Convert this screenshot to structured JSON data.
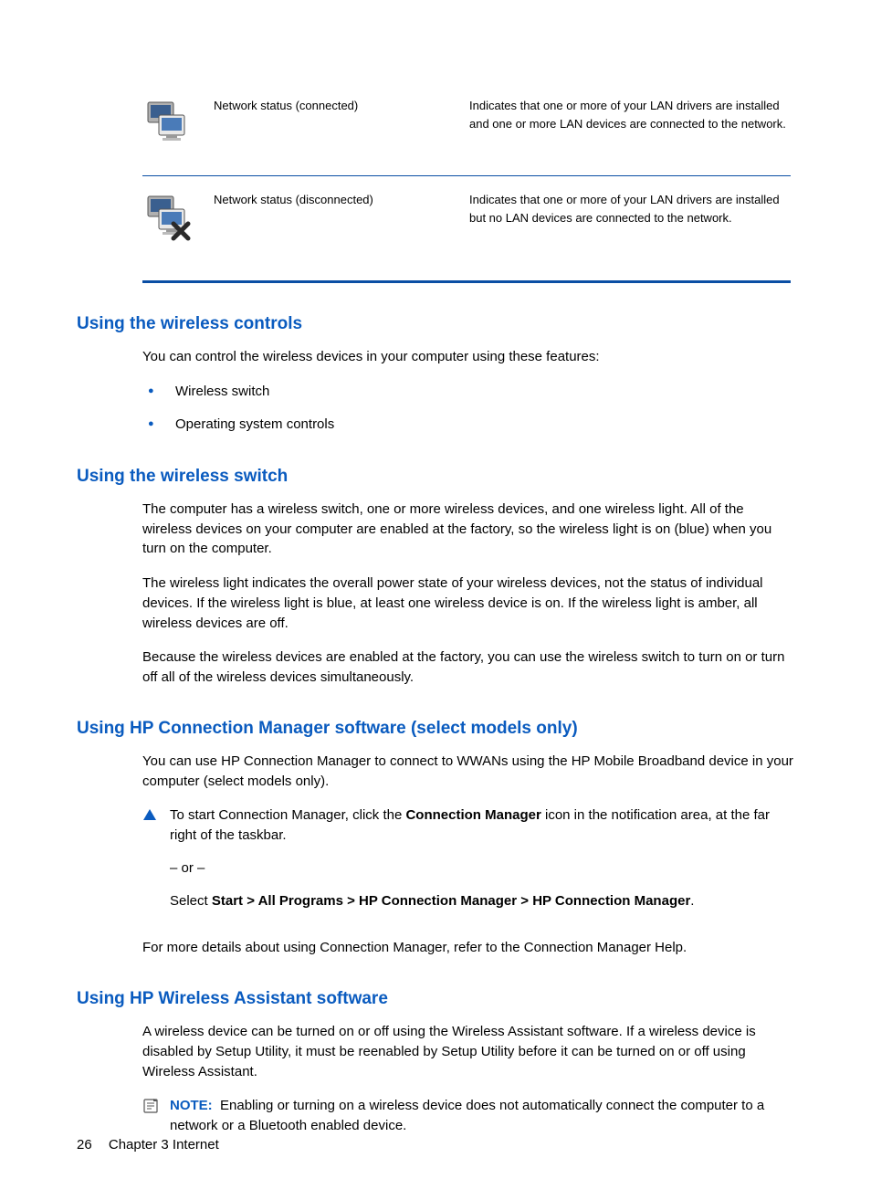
{
  "table": {
    "rows": [
      {
        "label": "Network status (connected)",
        "desc": "Indicates that one or more of your LAN drivers are installed and one or more LAN devices are connected to the network."
      },
      {
        "label": "Network status (disconnected)",
        "desc": "Indicates that one or more of your LAN drivers are installed but no LAN devices are connected to the network."
      }
    ]
  },
  "sections": {
    "s1": {
      "heading": "Using the wireless controls",
      "intro": "You can control the wireless devices in your computer using these features:",
      "bullets": [
        "Wireless switch",
        "Operating system controls"
      ]
    },
    "s2": {
      "heading": "Using the wireless switch",
      "p1": "The computer has a wireless switch, one or more wireless devices, and one wireless light. All of the wireless devices on your computer are enabled at the factory, so the wireless light is on (blue) when you turn on the computer.",
      "p2": "The wireless light indicates the overall power state of your wireless devices, not the status of individual devices. If the wireless light is blue, at least one wireless device is on. If the wireless light is amber, all wireless devices are off.",
      "p3": "Because the wireless devices are enabled at the factory, you can use the wireless switch to turn on or turn off all of the wireless devices simultaneously."
    },
    "s3": {
      "heading": "Using HP Connection Manager software (select models only)",
      "p1": "You can use HP Connection Manager to connect to WWANs using the HP Mobile Broadband device in your computer (select models only).",
      "callout_pre": "To start Connection Manager, click the ",
      "callout_bold1": "Connection Manager",
      "callout_post": " icon in the notification area, at the far right of the taskbar.",
      "or": "– or –",
      "select_pre": "Select ",
      "select_bold": "Start > All Programs > HP Connection Manager > HP Connection Manager",
      "select_post": ".",
      "p2": "For more details about using Connection Manager, refer to the Connection Manager Help."
    },
    "s4": {
      "heading": "Using HP Wireless Assistant software",
      "p1": "A wireless device can be turned on or off using the Wireless Assistant software. If a wireless device is disabled by Setup Utility, it must be reenabled by Setup Utility before it can be turned on or off using Wireless Assistant.",
      "note_label": "NOTE:",
      "note_body": "Enabling or turning on a wireless device does not automatically connect the computer to a network or a Bluetooth enabled device."
    }
  },
  "footer": {
    "page": "26",
    "chapter": "Chapter 3   Internet"
  }
}
